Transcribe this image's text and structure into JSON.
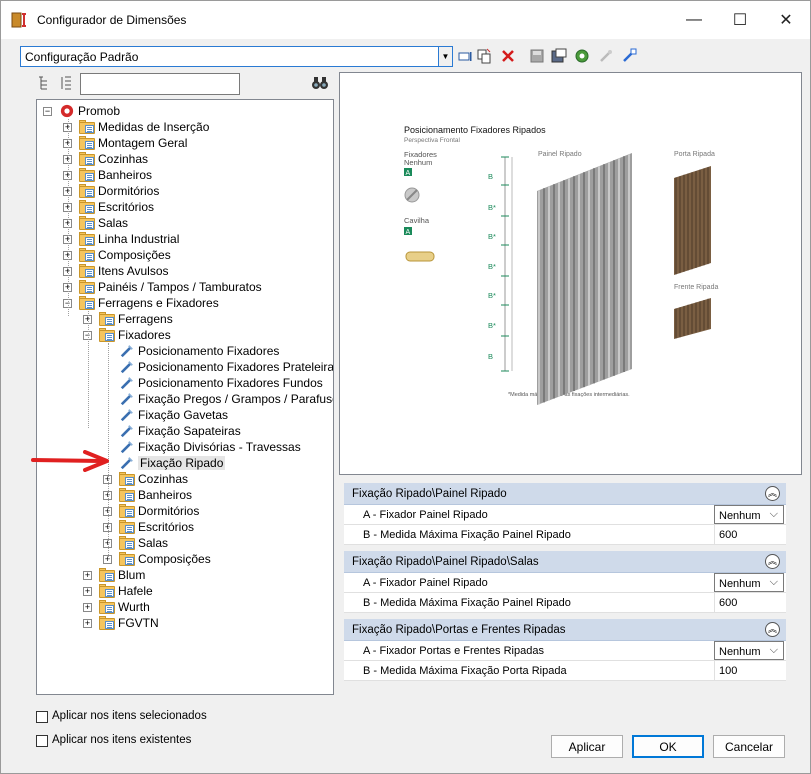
{
  "window": {
    "title": "Configurador de Dimensões"
  },
  "config": {
    "selected": "Configuração Padrão"
  },
  "search": {
    "value": ""
  },
  "tree": [
    {
      "label": "Promob",
      "level": 0
    },
    {
      "label": "Medidas de Inserção",
      "level": 1
    },
    {
      "label": "Montagem Geral",
      "level": 1
    },
    {
      "label": "Cozinhas",
      "level": 1
    },
    {
      "label": "Banheiros",
      "level": 1
    },
    {
      "label": "Dormitórios",
      "level": 1
    },
    {
      "label": "Escritórios",
      "level": 1
    },
    {
      "label": "Salas",
      "level": 1
    },
    {
      "label": "Linha Industrial",
      "level": 1
    },
    {
      "label": "Composições",
      "level": 1
    },
    {
      "label": "Itens Avulsos",
      "level": 1
    },
    {
      "label": "Painéis / Tampos / Tamburatos",
      "level": 1
    },
    {
      "label": "Ferragens e Fixadores",
      "level": 1
    },
    {
      "label": "Ferragens",
      "level": 2
    },
    {
      "label": "Fixadores",
      "level": 2
    },
    {
      "label": "Posicionamento Fixadores",
      "level": 3
    },
    {
      "label": "Posicionamento Fixadores Prateleiras",
      "level": 3
    },
    {
      "label": "Posicionamento Fixadores Fundos",
      "level": 3
    },
    {
      "label": "Fixação Pregos / Grampos / Parafusos",
      "level": 3
    },
    {
      "label": "Fixação Gavetas",
      "level": 3
    },
    {
      "label": "Fixação Sapateiras",
      "level": 3
    },
    {
      "label": "Fixação Divisórias - Travessas",
      "level": 3
    },
    {
      "label": "Fixação Ripado",
      "level": 3
    },
    {
      "label": "Cozinhas",
      "level": 3
    },
    {
      "label": "Banheiros",
      "level": 3
    },
    {
      "label": "Dormitórios",
      "level": 3
    },
    {
      "label": "Escritórios",
      "level": 3
    },
    {
      "label": "Salas",
      "level": 3
    },
    {
      "label": "Composições",
      "level": 3
    },
    {
      "label": "Blum",
      "level": 2
    },
    {
      "label": "Hafele",
      "level": 2
    },
    {
      "label": "Wurth",
      "level": 2
    },
    {
      "label": "FGVTN",
      "level": 2
    }
  ],
  "preview": {
    "title": "Posicionamento Fixadores Ripados",
    "subtitle": "Perspectiva Frontal",
    "fixadores_label": "Fixadores",
    "fixadores_value": "Nenhum",
    "badge_a": "A",
    "cavilha_label": "Cavilha",
    "painel_label": "Painel Ripado",
    "porta_label": "Porta Ripada",
    "frente_label": "Frente Ripada",
    "b": "B",
    "b_star": "B*",
    "note": "*Medida máxima entre as fixações intermediárias."
  },
  "sections": [
    {
      "title": "Fixação Ripado\\Painel Ripado",
      "rows": [
        {
          "key": "A - Fixador Painel Ripado",
          "value": "Nenhum"
        },
        {
          "key": "B - Medida Máxima Fixação Painel Ripado",
          "value": "600"
        }
      ]
    },
    {
      "title": "Fixação Ripado\\Painel Ripado\\Salas",
      "rows": [
        {
          "key": "A - Fixador Painel Ripado",
          "value": "Nenhum"
        },
        {
          "key": "B - Medida Máxima Fixação Painel Ripado",
          "value": "600"
        }
      ]
    },
    {
      "title": "Fixação Ripado\\Portas e Frentes Ripadas",
      "rows": [
        {
          "key": "A - Fixador Portas e Frentes Ripadas",
          "value": "Nenhum"
        },
        {
          "key": "B - Medida Máxima Fixação Porta Ripada",
          "value": "100"
        }
      ]
    }
  ],
  "options": {
    "apply_selected": "Aplicar nos itens selecionados",
    "apply_existing": "Aplicar nos itens existentes"
  },
  "buttons": {
    "apply": "Aplicar",
    "ok": "OK",
    "cancel": "Cancelar"
  },
  "colors": {
    "accent": "#0078d7",
    "section": "#cfdaea",
    "arrow": "#e02020",
    "badge": "#1a8a5a"
  }
}
